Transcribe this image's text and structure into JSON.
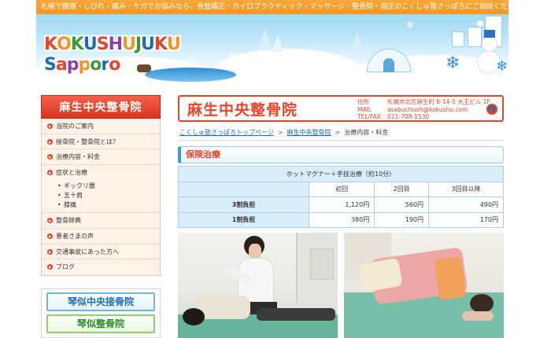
{
  "header": {
    "tagline": "札幌で腰痛・しびれ・痛み・ケガでお悩みなら、骨盤矯正・カイロプラクティック・マッサージ・整骨院・指圧のこくしゅ塾さっぽろにご相談ください。",
    "logo_line1": [
      "K",
      "O",
      "K",
      "U",
      "S",
      "H",
      "U",
      "J",
      "U",
      "K",
      "U"
    ],
    "logo_line2": [
      "S",
      "a",
      "p",
      "p",
      "o",
      "r",
      "o"
    ],
    "logo_colors": [
      "#e8442c",
      "#f39621",
      "#3a9a3a",
      "#1a6fb3",
      "#e8442c",
      "#8a3fb0",
      "#f39621",
      "#3a9a3a",
      "#1a6fb3",
      "#e8442c",
      "#f39621"
    ]
  },
  "sidebar": {
    "title": "麻生中央整骨院",
    "items": [
      {
        "label": "当院のご案内"
      },
      {
        "label": "接骨院・整骨院とは？"
      },
      {
        "label": "治療内容・料金"
      },
      {
        "label": "症状と治療"
      }
    ],
    "subitems": [
      {
        "label": "ギックリ腰"
      },
      {
        "label": "五十肩"
      },
      {
        "label": "膝痛"
      }
    ],
    "items2": [
      {
        "label": "整骨辞典"
      },
      {
        "label": "患者さまの声"
      },
      {
        "label": "交通事故にあった方へ"
      },
      {
        "label": "ブログ"
      }
    ],
    "banners": [
      {
        "label": "琴似中央接骨院"
      },
      {
        "label": "琴似整骨院"
      }
    ]
  },
  "clinic": {
    "name": "麻生中央整骨院",
    "address_label": "住所",
    "address": "札幌市北区麻生町 6-14-5 大王ビル 1F",
    "mail_label": "MAIL",
    "mail": "asabuchuoh@kokushu.com",
    "tel_label": "TEL/FAX",
    "tel": "011-708-1530"
  },
  "breadcrumb": {
    "items": [
      "こくしゅ塾さっぽろトップページ",
      "麻生中央整骨院",
      "治療内容・料金"
    ],
    "separator": ">"
  },
  "section": {
    "title": "保険治療"
  },
  "fees": {
    "title": "ホットマグナー＋手技治療（約10分）",
    "columns": [
      "初回",
      "2回目",
      "3回目以降"
    ],
    "rows": [
      {
        "label": "3割負担",
        "values": [
          "1,120円",
          "560円",
          "490円"
        ]
      },
      {
        "label": "1割負担",
        "values": [
          "380円",
          "190円",
          "170円"
        ]
      }
    ]
  },
  "colors": {
    "accent_red": "#e8442c",
    "accent_orange": "#f39621",
    "accent_blue": "#3d9bd6"
  }
}
